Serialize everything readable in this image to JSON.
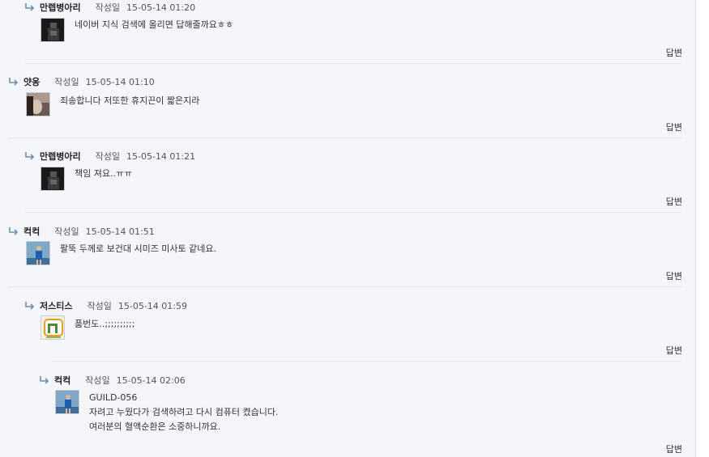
{
  "comments": [
    {
      "author": "만렙병아리",
      "label": "작성일",
      "date": "15-05-14 01:20",
      "lines": [
        "네이버 지식 검색에 올리면 답해줄까요ㅎㅎ"
      ],
      "reply": "답변"
    },
    {
      "author": "얏옹",
      "label": "작성일",
      "date": "15-05-14 01:10",
      "lines": [
        "죄송합니다 저또한 휴지끈이 짧은지라"
      ],
      "reply": "답변"
    },
    {
      "author": "만렙병아리",
      "label": "작성일",
      "date": "15-05-14 01:21",
      "lines": [
        "책임 져요..ㅠㅠ"
      ],
      "reply": "답변"
    },
    {
      "author": "컥컥",
      "label": "작성일",
      "date": "15-05-14 01:51",
      "lines": [
        "팔뚝 두께로 보건대 시미즈 미사토 같네요."
      ],
      "reply": "답변"
    },
    {
      "author": "저스티스",
      "label": "작성일",
      "date": "15-05-14 01:59",
      "lines": [
        "품번도..;;;;;;;;;;"
      ],
      "reply": "답변"
    },
    {
      "author": "컥컥",
      "label": "작성일",
      "date": "15-05-14 02:06",
      "lines": [
        "GUILD-056",
        "자려고 누웠다가 검색하려고 다시 컴퓨터 켰습니다.",
        "여러분의 혈액순환은 소중하니까요."
      ],
      "reply": "답변"
    }
  ],
  "avatars": [
    "dark-figure-avatar",
    "face-photo-avatar",
    "dark-figure-avatar",
    "sports-player-avatar",
    "bus-sign-avatar",
    "sports-player-avatar"
  ]
}
